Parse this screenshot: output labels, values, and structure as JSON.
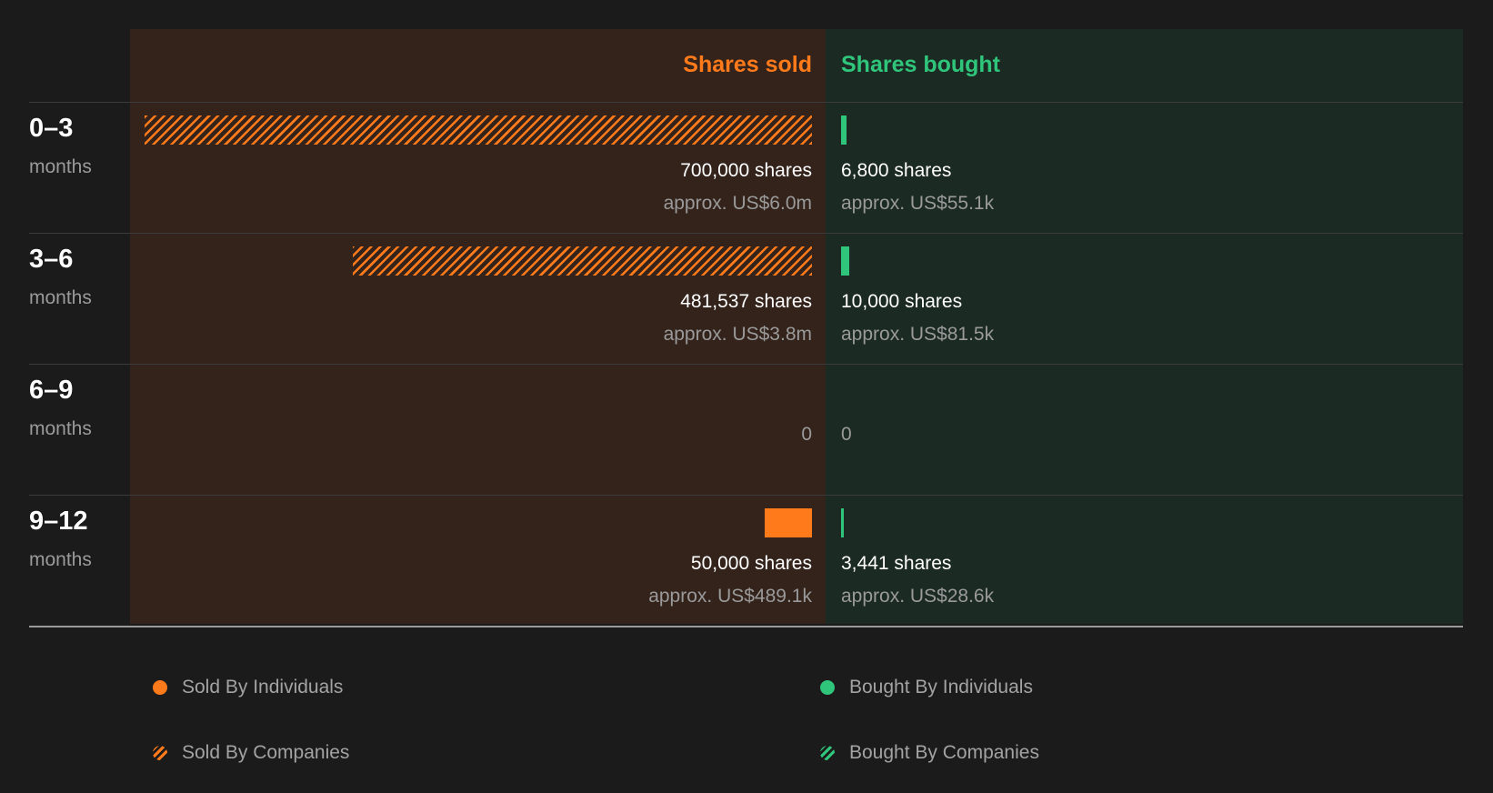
{
  "chart_data": {
    "type": "bar",
    "headers": {
      "sold": "Shares sold",
      "bought": "Shares bought"
    },
    "periods": [
      {
        "label": "0-3",
        "unit": "months",
        "sold": {
          "shares": 700000,
          "by": "companies",
          "shares_text": "700,000 shares",
          "approx_text": "approx. US$6.0m"
        },
        "bought": {
          "shares": 6800,
          "by": "individuals",
          "shares_text": "6,800 shares",
          "approx_text": "approx. US$55.1k"
        }
      },
      {
        "label": "3-6",
        "unit": "months",
        "sold": {
          "shares": 481537,
          "by": "companies",
          "shares_text": "481,537 shares",
          "approx_text": "approx. US$3.8m"
        },
        "bought": {
          "shares": 10000,
          "by": "individuals",
          "shares_text": "10,000 shares",
          "approx_text": "approx. US$81.5k"
        }
      },
      {
        "label": "6-9",
        "unit": "months",
        "sold": {
          "shares": 0,
          "by": "",
          "shares_text": "0",
          "approx_text": ""
        },
        "bought": {
          "shares": 0,
          "by": "",
          "shares_text": "0",
          "approx_text": ""
        }
      },
      {
        "label": "9-12",
        "unit": "months",
        "sold": {
          "shares": 50000,
          "by": "individuals",
          "shares_text": "50,000 shares",
          "approx_text": "approx. US$489.1k"
        },
        "bought": {
          "shares": 3441,
          "by": "individuals",
          "shares_text": "3,441 shares",
          "approx_text": "approx. US$28.6k"
        }
      }
    ],
    "legend": [
      {
        "key": "sold-ind",
        "label": "Sold By Individuals"
      },
      {
        "key": "bought-ind",
        "label": "Bought By Individuals"
      },
      {
        "key": "sold-co",
        "label": "Sold By Companies"
      },
      {
        "key": "bought-co",
        "label": "Bought By Companies"
      }
    ],
    "colors": {
      "sold": "#ff7a1a",
      "bought": "#2fc57a",
      "sold_panel": "#33231b",
      "bought_panel": "#1c2a24"
    }
  }
}
